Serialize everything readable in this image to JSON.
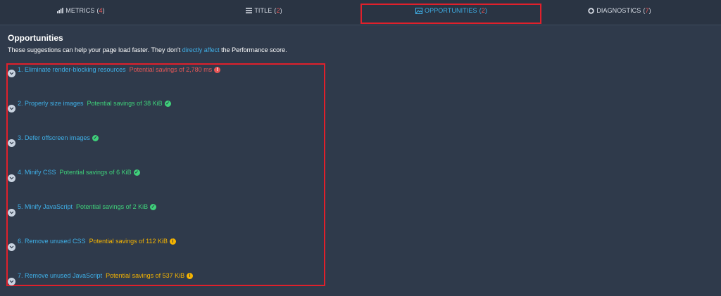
{
  "tabs": [
    {
      "label": "METRICS",
      "count": "4",
      "icon": "bar-chart-icon"
    },
    {
      "label": "TITLE",
      "count": "2",
      "icon": "stack-icon"
    },
    {
      "label": "OPPORTUNITIES",
      "count": "2",
      "icon": "image-icon"
    },
    {
      "label": "DIAGNOSTICS",
      "count": "7",
      "icon": "circle-icon"
    }
  ],
  "section": {
    "title": "Opportunities",
    "desc_before": "These suggestions can help your page load faster. They don't ",
    "desc_link": "directly affect",
    "desc_after": " the Performance score."
  },
  "opportunities": [
    {
      "title": "1. Eliminate render-blocking resources",
      "savings": "Potential savings of 2,780 ms",
      "status": "fail",
      "icon": "alert-icon"
    },
    {
      "title": "2. Properly size images",
      "savings": "Potential savings of 38 KiB",
      "status": "pass",
      "icon": "check-icon"
    },
    {
      "title": "3. Defer offscreen images",
      "savings": "",
      "status": "pass",
      "icon": "check-icon"
    },
    {
      "title": "4. Minify CSS",
      "savings": "Potential savings of 6 KiB",
      "status": "pass",
      "icon": "check-icon"
    },
    {
      "title": "5. Minify JavaScript",
      "savings": "Potential savings of 2 KiB",
      "status": "pass",
      "icon": "check-icon"
    },
    {
      "title": "6. Remove unused CSS",
      "savings": "Potential savings of 112 KiB",
      "status": "warn",
      "icon": "info-icon"
    },
    {
      "title": "7. Remove unused JavaScript",
      "savings": "Potential savings of 537 KiB",
      "status": "warn",
      "icon": "info-icon"
    }
  ],
  "colors": {
    "background": "#2f3a4b",
    "accent": "#3fb0e8",
    "fail": "#e85757",
    "pass": "#3fd17a",
    "warn": "#f5b400",
    "highlight": "#e0202b"
  }
}
